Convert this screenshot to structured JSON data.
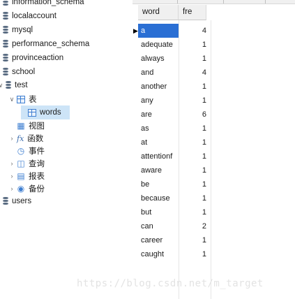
{
  "navigator": {
    "databases": [
      {
        "name": "information_schema"
      },
      {
        "name": "localaccount"
      },
      {
        "name": "mysql"
      },
      {
        "name": "performance_schema"
      },
      {
        "name": "provinceaction"
      },
      {
        "name": "school"
      },
      {
        "name": "test"
      }
    ],
    "test_children": {
      "tables_label": "表",
      "tables": [
        "words"
      ],
      "views_label": "视图",
      "functions_label": "函数",
      "events_label": "事件",
      "queries_label": "查询",
      "reports_label": "报表",
      "backups_label": "备份"
    },
    "trailing_db": "users"
  },
  "grid": {
    "columns": [
      "word",
      "fre"
    ],
    "rows": [
      {
        "word": "a",
        "fre": "4"
      },
      {
        "word": "adequate",
        "fre": "1"
      },
      {
        "word": "always",
        "fre": "1"
      },
      {
        "word": "and",
        "fre": "4"
      },
      {
        "word": "another",
        "fre": "1"
      },
      {
        "word": "any",
        "fre": "1"
      },
      {
        "word": "are",
        "fre": "6"
      },
      {
        "word": "as",
        "fre": "1"
      },
      {
        "word": "at",
        "fre": "1"
      },
      {
        "word": "attentionf",
        "fre": "1"
      },
      {
        "word": "aware",
        "fre": "1"
      },
      {
        "word": "be",
        "fre": "1"
      },
      {
        "word": "because",
        "fre": "1"
      },
      {
        "word": "but",
        "fre": "1"
      },
      {
        "word": "can",
        "fre": "2"
      },
      {
        "word": "career",
        "fre": "1"
      },
      {
        "word": "caught",
        "fre": "1"
      }
    ],
    "selected_row_index": 0
  },
  "watermark": "https://blog.csdn.net/m_target"
}
